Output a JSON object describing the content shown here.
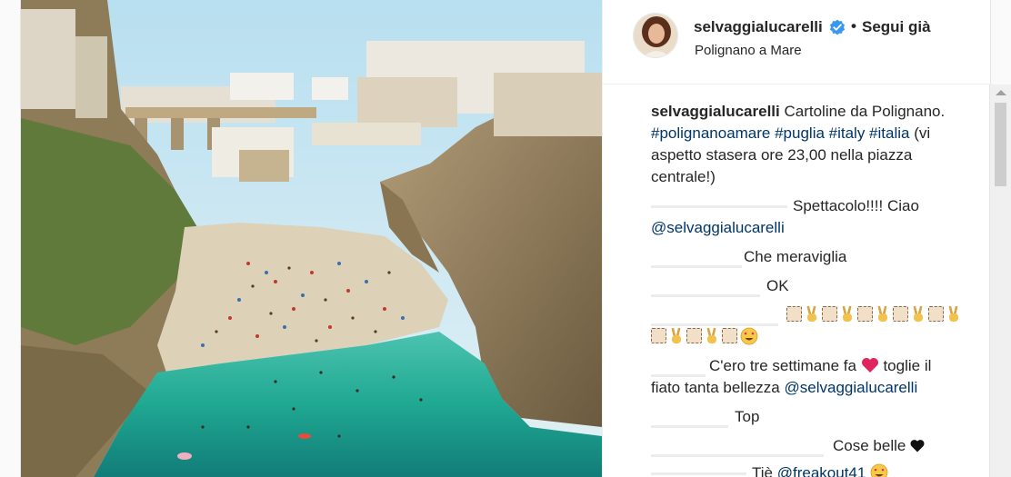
{
  "post": {
    "username": "selvaggialucarelli",
    "follow_separator": "•",
    "follow_status": "Segui già",
    "location": "Polignano a Mare"
  },
  "caption": {
    "username": "selvaggialucarelli",
    "line1_text": "Cartoline da Polignano.",
    "line2_tags": "#polignanoamare #puglia #italy #italia",
    "line2_text": "(vi",
    "line3_text": "aspetto stasera ore 23,00 nella piazza",
    "line4_text": "centrale!)"
  },
  "comments": [
    {
      "text": "Spettacolo!!!! Ciao",
      "mention": "@selvaggialucarelli"
    },
    {
      "text": "Che meraviglia"
    },
    {
      "text": "OK"
    },
    {
      "emoji_row1": "emoji-hands",
      "emoji_row2": "emoji-hands-smile"
    },
    {
      "text_before": "C'ero tre settimane fa",
      "text_after": "toglie il",
      "text_line2": "fiato tanta bellezza",
      "mention": "@selvaggialucarelli"
    },
    {
      "text": "Top"
    },
    {
      "text": "Cose belle"
    },
    {
      "text": "Tiè",
      "mention": "@freakout41"
    }
  ],
  "icons": {
    "verified": "verified-badge-icon",
    "red_heart": "red-heart-icon",
    "black_heart": "black-heart-icon",
    "smile": "heart-eyes-emoji",
    "hand": "victory-hand-emoji",
    "missing_glyph": "missing-glyph-box"
  },
  "colors": {
    "link": "#003569",
    "verified": "#3897f0",
    "heart": "#e0245e",
    "sea": "#2bb39e"
  }
}
